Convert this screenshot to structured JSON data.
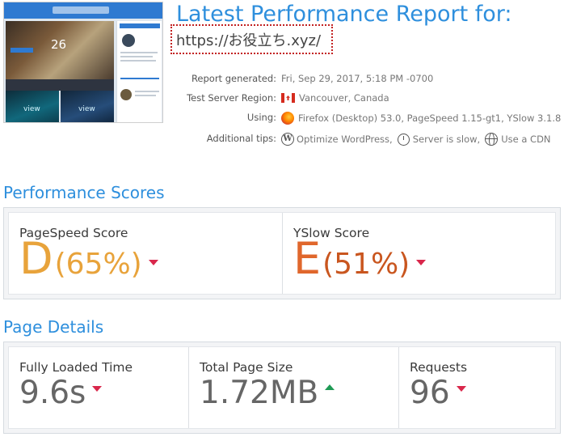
{
  "header": {
    "title": "Latest Performance Report for:",
    "url": "https://お役立ち.xyz/",
    "thumbnail": {
      "hero_number": "26",
      "card_views": [
        "view",
        "view"
      ]
    }
  },
  "meta": {
    "generated_label": "Report generated:",
    "generated_value": "Fri, Sep 29, 2017, 5:18 PM -0700",
    "region_label": "Test Server Region:",
    "region_value": "Vancouver, Canada",
    "region_icon": "canada-flag-icon",
    "using_label": "Using:",
    "using_value": "Firefox (Desktop) 53.0, PageSpeed 1.15-gt1, YSlow 3.1.8",
    "using_icon": "firefox-icon",
    "tips_label": "Additional tips:",
    "tips": [
      {
        "label": "Optimize WordPress,",
        "icon": "wordpress-icon"
      },
      {
        "label": "Server is slow,",
        "icon": "clock-icon"
      },
      {
        "label": "Use a CDN",
        "icon": "globe-icon"
      }
    ]
  },
  "scores": {
    "section_title": "Performance Scores",
    "pagespeed": {
      "label": "PageSpeed Score",
      "grade": "D",
      "percent": "(65%)",
      "trend": "down",
      "color": "#e8a33b"
    },
    "yslow": {
      "label": "YSlow Score",
      "grade": "E",
      "percent": "(51%)",
      "trend": "down",
      "color": "#e0672c"
    }
  },
  "details": {
    "section_title": "Page Details",
    "load_time": {
      "label": "Fully Loaded Time",
      "value": "9.6s",
      "trend": "down"
    },
    "page_size": {
      "label": "Total Page Size",
      "value": "1.72MB",
      "trend": "up"
    },
    "requests": {
      "label": "Requests",
      "value": "96",
      "trend": "down"
    }
  },
  "colors": {
    "accent": "#2e8fdd",
    "trend_down": "#d9274b",
    "trend_up": "#1f9a55",
    "url_highlight": "#c22121"
  }
}
